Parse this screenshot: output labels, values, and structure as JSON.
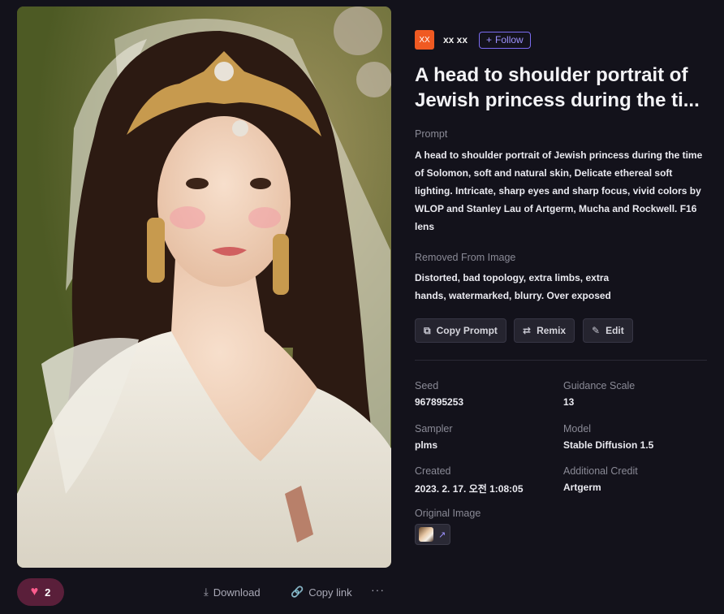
{
  "image": {
    "alt": "Portrait of a princess wearing a golden tiara and white veil"
  },
  "author": {
    "avatar_text": "XX",
    "name": "xx xx",
    "follow_label": "Follow",
    "follow_icon": "plus-icon"
  },
  "title": "A head to shoulder portrait of Jewish princess during the ti...",
  "prompt": {
    "label": "Prompt",
    "text": "A head to shoulder portrait of Jewish princess during the time of Solomon, soft and natural skin, Delicate ethereal soft lighting. Intricate, sharp eyes and sharp focus, vivid colors by WLOP and Stanley Lau of Artgerm, Mucha and Rockwell. F16 lens"
  },
  "removed": {
    "label": "Removed From Image",
    "text": "Distorted, bad topology, extra limbs, extra hands, watermarked, blurry. Over exposed"
  },
  "buttons": {
    "copy_prompt": "Copy Prompt",
    "remix": "Remix",
    "edit": "Edit"
  },
  "meta": {
    "seed_label": "Seed",
    "seed": "967895253",
    "guidance_label": "Guidance Scale",
    "guidance": "13",
    "sampler_label": "Sampler",
    "sampler": "plms",
    "model_label": "Model",
    "model": "Stable Diffusion 1.5",
    "created_label": "Created",
    "created": "2023. 2. 17. 오전 1:08:05",
    "credit_label": "Additional Credit",
    "credit": "Artgerm",
    "original_label": "Original Image"
  },
  "bottom": {
    "like_count": "2",
    "download_label": "Download",
    "copy_link_label": "Copy link",
    "more_label": "···"
  },
  "colors": {
    "accent": "#7b6cf0",
    "like_bg": "#5a1f3a",
    "heart": "#ff5c8d",
    "avatar": "#f05a22"
  }
}
